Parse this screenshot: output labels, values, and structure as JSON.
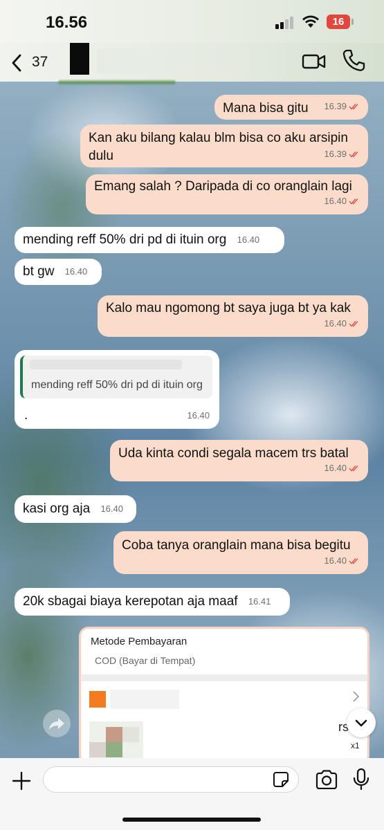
{
  "status_bar": {
    "time": "16.56",
    "battery": "16"
  },
  "header": {
    "back_count": "37"
  },
  "messages": [
    {
      "dir": "out",
      "text": "Mana bisa gitu",
      "time": "16.39"
    },
    {
      "dir": "out",
      "text": "Kan aku bilang kalau blm bisa co aku arsipin dulu",
      "time": "16.39"
    },
    {
      "dir": "out",
      "text": "Emang salah ? Daripada di co oranglain lagi",
      "time": "16.40"
    },
    {
      "dir": "in",
      "text": "mending reff 50% dri pd di ituin org",
      "time": "16.40"
    },
    {
      "dir": "in",
      "text": "bt gw",
      "time": "16.40"
    },
    {
      "dir": "out",
      "text": "Kalo mau ngomong bt saya juga bt ya kak",
      "time": "16.40"
    },
    {
      "dir": "in",
      "text": ".",
      "time": "16.40",
      "quote": "mending reff 50% dri pd di ituin org"
    },
    {
      "dir": "out",
      "text": "Uda kinta condi segala macem trs batal",
      "time": "16.40"
    },
    {
      "dir": "in",
      "text": "kasi org aja",
      "time": "16.40"
    },
    {
      "dir": "out",
      "text": "Coba tanya oranglain mana bisa begitu",
      "time": "16.40"
    },
    {
      "dir": "in",
      "text": "20k sbagai biaya kerepotan aja maaf",
      "time": "16.41"
    }
  ],
  "payment_card": {
    "title": "Metode Pembayaran",
    "method": "COD (Bayar di Tempat)",
    "price_fragment": "rs",
    "qty": "x1"
  },
  "composer": {
    "placeholder": ""
  },
  "colors": {
    "outgoing_bubble": "#fbdccb",
    "incoming_bubble": "#ffffff",
    "read_tick": "#d9534f",
    "accent_orange": "#f47c20"
  },
  "icons": [
    "back-chevron-icon",
    "video-call-icon",
    "phone-icon",
    "double-check-icon",
    "share-icon",
    "chevron-down-icon",
    "plus-icon",
    "sticker-icon",
    "camera-icon",
    "microphone-icon"
  ]
}
